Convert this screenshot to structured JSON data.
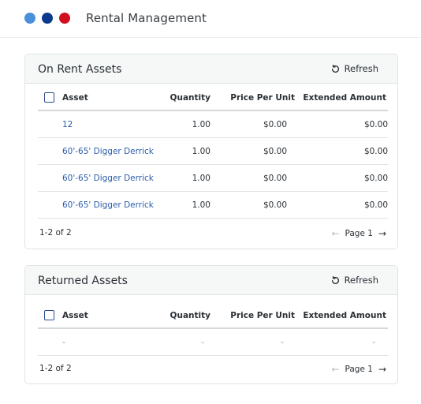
{
  "window": {
    "dots": [
      {
        "name": "dot-blue-light",
        "color": "#4a90d9"
      },
      {
        "name": "dot-blue-dark",
        "color": "#0b3a8c"
      },
      {
        "name": "dot-red",
        "color": "#d0101f"
      }
    ],
    "title": "Rental Management"
  },
  "on_rent": {
    "title": "On Rent Assets",
    "refresh_label": "Refresh",
    "columns": {
      "asset": "Asset",
      "quantity": "Quantity",
      "price": "Price Per Unit",
      "extended": "Extended Amount"
    },
    "rows": [
      {
        "asset": "12",
        "quantity": "1.00",
        "price": "$0.00",
        "extended": "$0.00"
      },
      {
        "asset": "60'-65' Digger Derrick",
        "quantity": "1.00",
        "price": "$0.00",
        "extended": "$0.00"
      },
      {
        "asset": "60'-65' Digger Derrick",
        "quantity": "1.00",
        "price": "$0.00",
        "extended": "$0.00"
      },
      {
        "asset": "60'-65' Digger Derrick",
        "quantity": "1.00",
        "price": "$0.00",
        "extended": "$0.00"
      }
    ],
    "range": "1-2 of 2",
    "page": "Page 1"
  },
  "returned": {
    "title": "Returned Assets",
    "refresh_label": "Refresh",
    "columns": {
      "asset": "Asset",
      "quantity": "Quantity",
      "price": "Price Per Unit",
      "extended": "Extended Amount"
    },
    "rows": [
      {
        "asset": "-",
        "quantity": "-",
        "price": "-",
        "extended": "-"
      }
    ],
    "range": "1-2 of 2",
    "page": "Page 1"
  },
  "icons": {
    "refresh": "refresh-icon",
    "prev": "arrow-left-icon",
    "next": "arrow-right-icon"
  }
}
